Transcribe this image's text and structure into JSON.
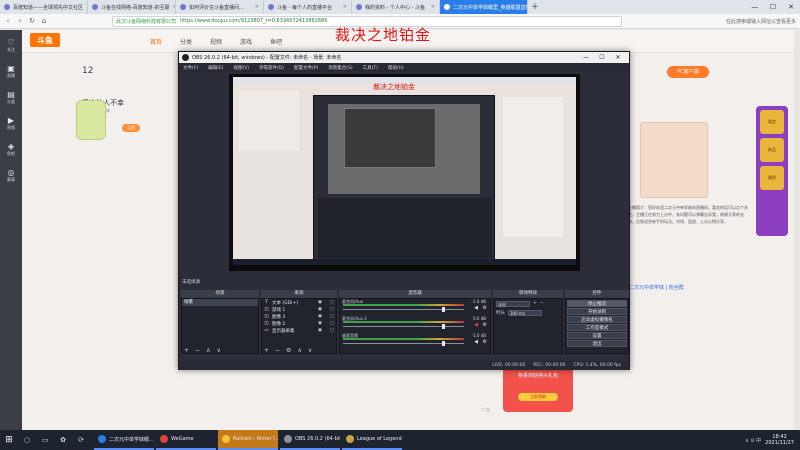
{
  "browser": {
    "tabs": [
      {
        "label": "百度知道——全球领先中文社区"
      },
      {
        "label": "斗鱼在线网络-百度知道-的互联"
      },
      {
        "label": "如何评价在斗鱼直播间..."
      },
      {
        "label": "斗鱼 - 每个人的直播平台"
      },
      {
        "label": "我的资料 - 个人中心 - 斗鱼"
      },
      {
        "label": "二次元中单学妹眼里_英雄联盟直播"
      }
    ],
    "active_tab_index": 5,
    "address_secure_label": "武汉斗鱼网络科技有限公司",
    "url": "https://www.douyu.com/9123807_t=0.6334572413862685",
    "search_hint": "在此搜索或输入网址以查看更多"
  },
  "site": {
    "logo": "斗鱼",
    "nav": [
      "首页",
      "分类",
      "视频",
      "游戏",
      "鱼吧"
    ],
    "room_number": "12",
    "streamer_name": "爱会让人不幸",
    "streamer_sub": "二次元中单学妹",
    "tag": "订阅",
    "red_title": "裁决之地铂金",
    "login_label": "PC客户端",
    "right_text": "主播简介：您好欢迎二次元中单学妹的直播间，喜欢的话可以点个关注，主播正在努力上分中，有问题可以弹幕告诉我，谢谢大家的支持。比较适合新手的玩法，对线、团战、上分心得分享。",
    "right_link": "二次元中单学妹 | 粉丝群",
    "ad_title": "恭喜你获得大礼包",
    "ad_button": "立即领取",
    "ad_label": "广告",
    "leftbar": [
      {
        "icon": "♡",
        "label": "关注"
      },
      {
        "icon": "▣",
        "label": "直播"
      },
      {
        "icon": "▤",
        "label": "分类"
      },
      {
        "icon": "▶",
        "label": "视频"
      },
      {
        "icon": "◈",
        "label": "鱼吧"
      },
      {
        "icon": "◎",
        "label": "赛事"
      }
    ],
    "side_ads": [
      "限定",
      "新品",
      "福利"
    ]
  },
  "obs": {
    "title": "OBS 26.0.2 (64-bit, windows) - 配置文件: 未命名 - 场景: 未命名",
    "menu": [
      "文件(F)",
      "编辑(E)",
      "视图(V)",
      "停靠部件(D)",
      "配置文件(P)",
      "场景集合(S)",
      "工具(T)",
      "帮助(H)"
    ],
    "preview_red": "裁决之地铂金",
    "status_label": "未选择源",
    "docks": {
      "scenes": "场景",
      "sources": "来源",
      "mixer": "混音器",
      "transitions": "转场特效",
      "controls": "控件"
    },
    "scenes": [
      "场景"
    ],
    "sources": [
      {
        "icon": "T",
        "name": "文本 (GDI+)"
      },
      {
        "icon": "◫",
        "name": "游戏 1"
      },
      {
        "icon": "◫",
        "name": "图像 3"
      },
      {
        "icon": "◫",
        "name": "图像 2"
      },
      {
        "icon": "▭",
        "name": "显示器采集"
      }
    ],
    "mixer": [
      {
        "name": "麦克风/Aux",
        "db": "-1.0 dB",
        "muted": false
      },
      {
        "name": "麦克风/Aux 2",
        "db": "0.0 dB",
        "muted": true
      },
      {
        "name": "桌面音频",
        "db": "-1.0 dB",
        "muted": false
      }
    ],
    "transition": {
      "type": "淡出",
      "duration_label": "时长",
      "duration": "300 ms"
    },
    "controls": [
      "停止推流",
      "开始录制",
      "启动虚拟摄像机",
      "工作室模式",
      "设置",
      "退出"
    ],
    "status": {
      "live": "LIVE: 00:00:00",
      "rec": "REC: 00:00:00",
      "cpu": "CPU: 1.4%, 60.00 fps"
    }
  },
  "taskbar": {
    "start_icon": "⊞",
    "icons": [
      "○",
      "▭",
      "✿",
      "⟳"
    ],
    "tasks": [
      {
        "label": "二次元中单学妹眼...",
        "color": "#2b7de9",
        "highlight": false
      },
      {
        "label": "WeGame",
        "color": "#e0413c",
        "highlight": false
      },
      {
        "label": "Rollrain - Aimer (...",
        "color": "#f3c23b",
        "highlight": true
      },
      {
        "label": "OBS 26.0.2 (64-bit...",
        "color": "#8a8f9c",
        "highlight": false
      },
      {
        "label": "League of Legends",
        "color": "#c8a44a",
        "highlight": false
      }
    ],
    "time": "18:42",
    "date": "2021/11/27",
    "tray": "∧  ⊙  中"
  }
}
